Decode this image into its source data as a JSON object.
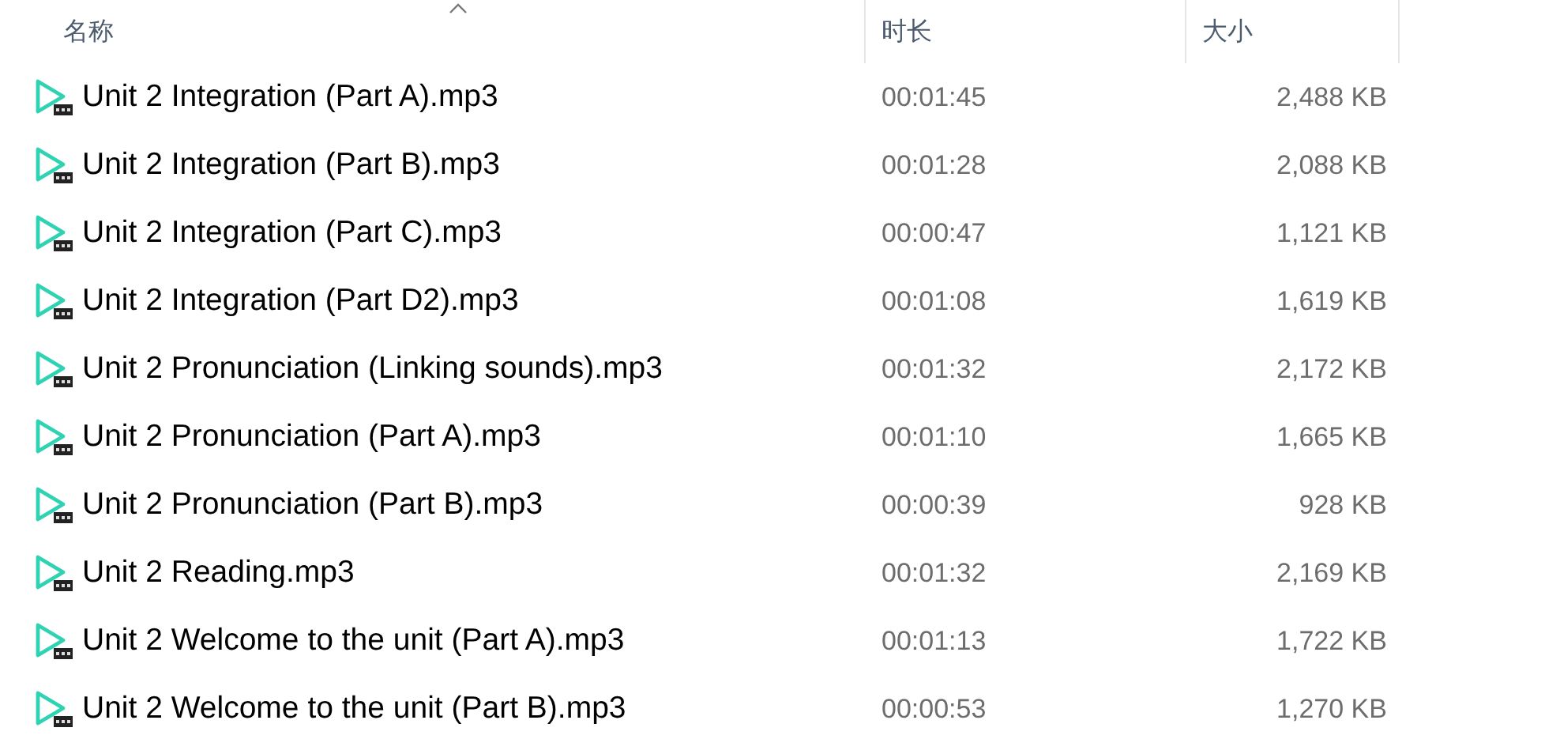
{
  "columns": [
    {
      "label": "名称",
      "sorted": true
    },
    {
      "label": "时长",
      "sorted": false
    },
    {
      "label": "大小",
      "sorted": false
    }
  ],
  "files": [
    {
      "name": "Unit 2 Integration (Part A).mp3",
      "duration": "00:01:45",
      "size": "2,488 KB"
    },
    {
      "name": "Unit 2 Integration (Part B).mp3",
      "duration": "00:01:28",
      "size": "2,088 KB"
    },
    {
      "name": "Unit 2 Integration (Part C).mp3",
      "duration": "00:00:47",
      "size": "1,121 KB"
    },
    {
      "name": "Unit 2 Integration (Part D2).mp3",
      "duration": "00:01:08",
      "size": "1,619 KB"
    },
    {
      "name": "Unit 2 Pronunciation (Linking sounds).mp3",
      "duration": "00:01:32",
      "size": "2,172 KB"
    },
    {
      "name": "Unit 2 Pronunciation (Part A).mp3",
      "duration": "00:01:10",
      "size": "1,665 KB"
    },
    {
      "name": "Unit 2 Pronunciation (Part B).mp3",
      "duration": "00:00:39",
      "size": "928 KB"
    },
    {
      "name": "Unit 2 Reading.mp3",
      "duration": "00:01:32",
      "size": "2,169 KB"
    },
    {
      "name": "Unit 2 Welcome to the unit (Part A).mp3",
      "duration": "00:01:13",
      "size": "1,722 KB"
    },
    {
      "name": "Unit 2 Welcome to the unit (Part B).mp3",
      "duration": "00:00:53",
      "size": "1,270 KB"
    }
  ]
}
